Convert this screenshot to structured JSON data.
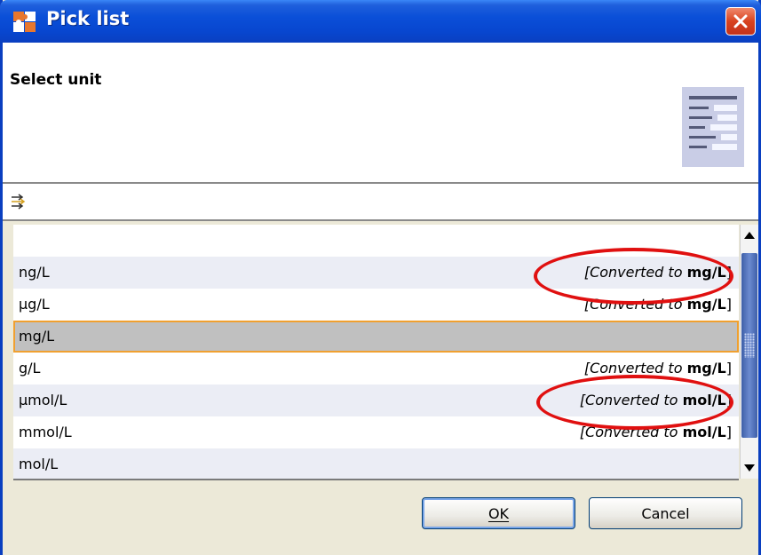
{
  "window": {
    "title": "Pick list",
    "app_icon": "puzzle-icon",
    "close_icon": "close-icon"
  },
  "header": {
    "heading": "Select unit",
    "graphic_icon": "form-list-icon"
  },
  "toolbar": {
    "filter_icon": "filter-arrows-icon"
  },
  "list": {
    "rows": [
      {
        "unit": "",
        "conv_prefix": "",
        "conv_target": "",
        "conv_suffix": ""
      },
      {
        "unit": "ng/L",
        "conv_prefix": "[Converted to ",
        "conv_target": "mg/L",
        "conv_suffix": "]"
      },
      {
        "unit": "µg/L",
        "conv_prefix": "[Converted to ",
        "conv_target": "mg/L",
        "conv_suffix": "]"
      },
      {
        "unit": "mg/L",
        "conv_prefix": "",
        "conv_target": "",
        "conv_suffix": "",
        "selected": true
      },
      {
        "unit": "g/L",
        "conv_prefix": "[Converted to ",
        "conv_target": "mg/L",
        "conv_suffix": "]"
      },
      {
        "unit": "µmol/L",
        "conv_prefix": "[Converted to ",
        "conv_target": "mol/L",
        "conv_suffix": "]"
      },
      {
        "unit": "mmol/L",
        "conv_prefix": "[Converted to ",
        "conv_target": "mol/L",
        "conv_suffix": "]"
      },
      {
        "unit": "mol/L",
        "conv_prefix": "",
        "conv_target": "",
        "conv_suffix": ""
      }
    ]
  },
  "buttons": {
    "ok": "OK",
    "cancel": "Cancel"
  },
  "colors": {
    "titlebar": "#0a4fd8",
    "selection_border": "#f0a030",
    "selection_bg": "#c0c0c0",
    "annotation": "#e01010",
    "scroll_thumb": "#4a6cb8"
  }
}
